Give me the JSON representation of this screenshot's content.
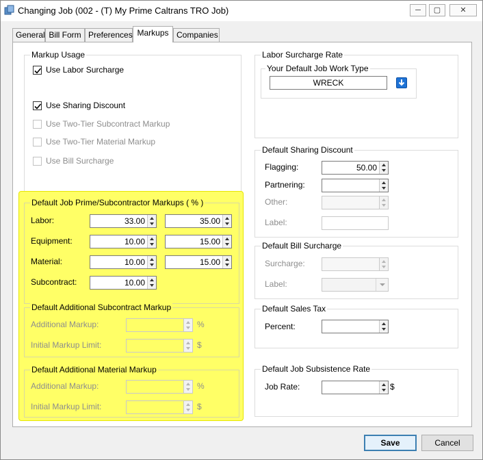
{
  "window": {
    "title": "Changing Job  (002 - (T) My Prime Caltrans TRO Job)",
    "minimize": "─",
    "maximize": "▢",
    "close": "✕"
  },
  "tabs": [
    "General",
    "Bill Form",
    "Preferences",
    "Markups",
    "Companies"
  ],
  "active_tab": "Markups",
  "markup_usage": {
    "title": "Markup Usage",
    "items": [
      {
        "label": "Use Labor Surcharge",
        "checked": true,
        "enabled": true
      },
      {
        "label": "Use Sharing Discount",
        "checked": true,
        "enabled": true
      },
      {
        "label": "Use Two-Tier Subcontract Markup",
        "checked": false,
        "enabled": false
      },
      {
        "label": "Use Two-Tier Material Markup",
        "checked": false,
        "enabled": false
      },
      {
        "label": "Use Bill Surcharge",
        "checked": false,
        "enabled": false
      }
    ]
  },
  "prime_sub": {
    "title": "Default Job Prime/Subcontractor Markups ( % )",
    "rows": [
      {
        "label": "Labor:",
        "prime": "33.00",
        "sub": "35.00"
      },
      {
        "label": "Equipment:",
        "prime": "10.00",
        "sub": "15.00"
      },
      {
        "label": "Material:",
        "prime": "10.00",
        "sub": "15.00"
      },
      {
        "label": "Subcontract:",
        "prime": "10.00"
      }
    ]
  },
  "add_subcontract": {
    "title": "Default Additional Subcontract Markup",
    "additional_label": "Additional Markup:",
    "additional_unit": "%",
    "limit_label": "Initial Markup Limit:",
    "limit_unit": "$"
  },
  "add_material": {
    "title": "Default Additional Material Markup",
    "additional_label": "Additional Markup:",
    "additional_unit": "%",
    "limit_label": "Initial Markup Limit:",
    "limit_unit": "$"
  },
  "labor_surcharge": {
    "title": "Labor Surcharge Rate",
    "inner_title": "Your Default Job Work Type",
    "work_type": "WRECK"
  },
  "sharing_discount": {
    "title": "Default Sharing Discount",
    "flagging_label": "Flagging:",
    "flagging_value": "50.00",
    "partnering_label": "Partnering:",
    "other_label": "Other:",
    "label_label": "Label:"
  },
  "bill_surcharge": {
    "title": "Default Bill Surcharge",
    "surcharge_label": "Surcharge:",
    "label_label": "Label:"
  },
  "sales_tax": {
    "title": "Default Sales Tax",
    "percent_label": "Percent:"
  },
  "subsistence": {
    "title": "Default Job Subsistence Rate",
    "job_rate_label": "Job Rate:",
    "unit": "$"
  },
  "buttons": {
    "save": "Save",
    "cancel": "Cancel"
  },
  "colors": {
    "highlight": "#ffff66",
    "accent": "#1e73d6"
  }
}
